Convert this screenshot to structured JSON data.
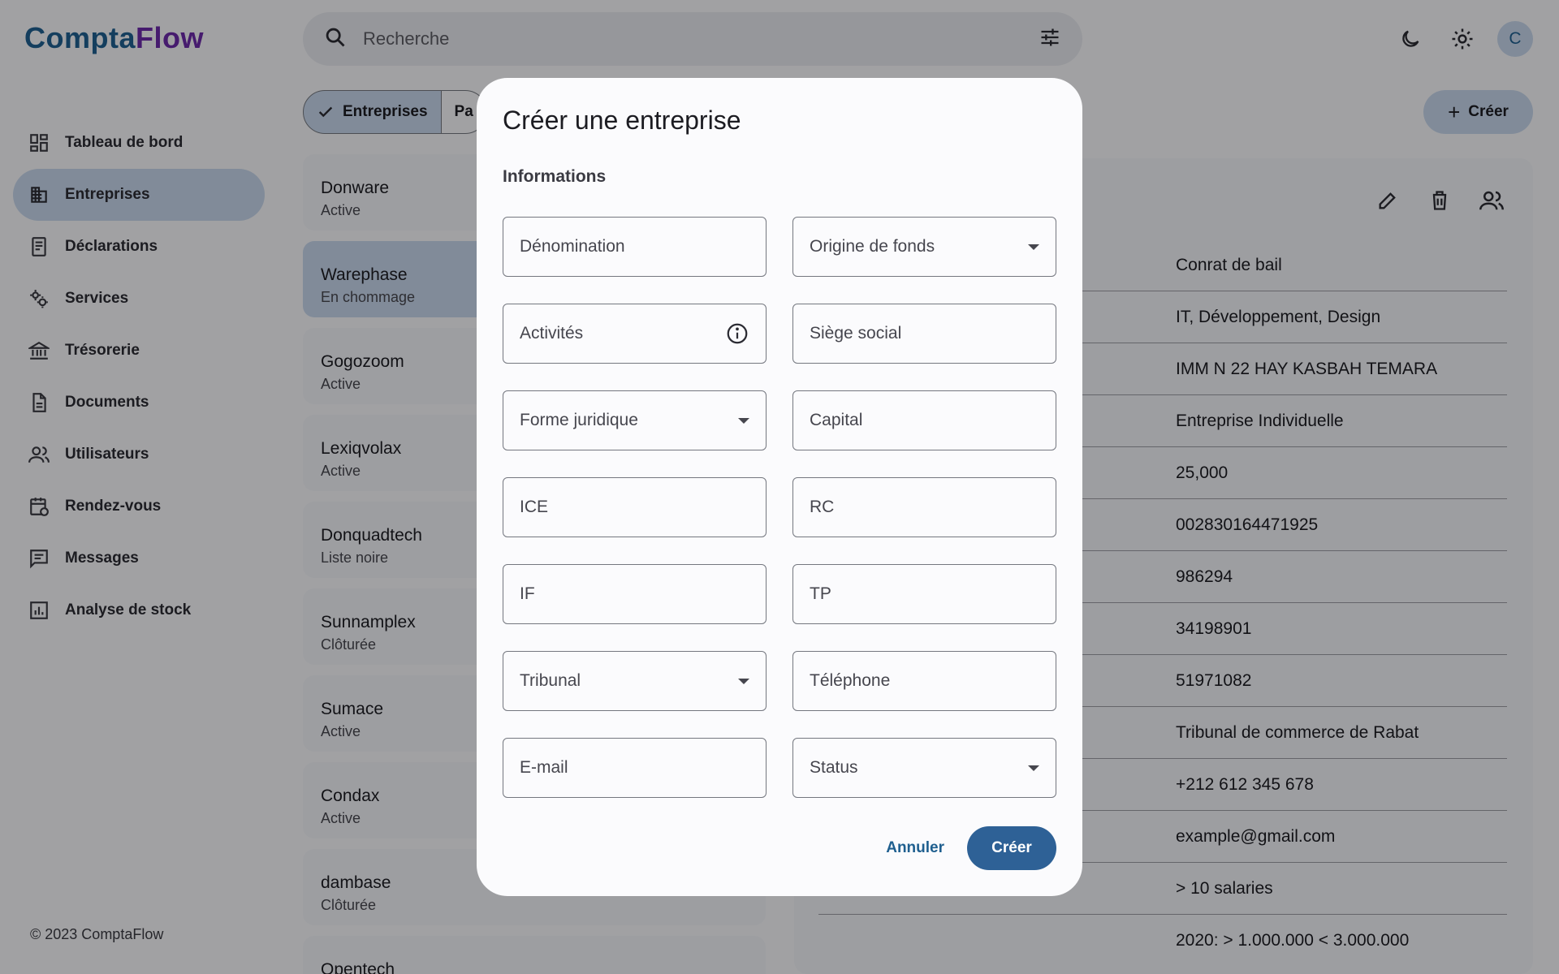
{
  "app": {
    "logo_part1": "Compta",
    "logo_part2": "Flow",
    "footer": "© 2023 ComptaFlow",
    "colors": {
      "primary": "#1f5f8f",
      "accent": "#6b2aa8",
      "selected": "#c4d4e8",
      "button": "#2e6196"
    }
  },
  "sidebar": {
    "items": [
      {
        "label": "Tableau de bord",
        "icon": "dashboard-icon"
      },
      {
        "label": "Entreprises",
        "icon": "building-icon"
      },
      {
        "label": "Déclarations",
        "icon": "document-list-icon"
      },
      {
        "label": "Services",
        "icon": "gears-icon"
      },
      {
        "label": "Trésorerie",
        "icon": "bank-icon"
      },
      {
        "label": "Documents",
        "icon": "file-icon"
      },
      {
        "label": "Utilisateurs",
        "icon": "users-icon"
      },
      {
        "label": "Rendez-vous",
        "icon": "calendar-icon"
      },
      {
        "label": "Messages",
        "icon": "message-icon"
      },
      {
        "label": "Analyse de stock",
        "icon": "chart-icon"
      }
    ]
  },
  "header": {
    "search_placeholder": "Recherche",
    "avatar_initial": "C"
  },
  "toolbar": {
    "chip_selected": "Entreprises",
    "chip_other": "Pa",
    "create_label": "Créer"
  },
  "companies": [
    {
      "name": "Donware",
      "status": "Active"
    },
    {
      "name": "Warephase",
      "status": "En chommage"
    },
    {
      "name": "Gogozoom",
      "status": "Active"
    },
    {
      "name": "Lexiqvolax",
      "status": "Active"
    },
    {
      "name": "Donquadtech",
      "status": "Liste noire"
    },
    {
      "name": "Sunnamplex",
      "status": "Clôturée"
    },
    {
      "name": "Sumace",
      "status": "Active"
    },
    {
      "name": "Condax",
      "status": "Active"
    },
    {
      "name": "dambase",
      "status": "Clôturée"
    },
    {
      "name": "Opentech",
      "status": ""
    }
  ],
  "detail": {
    "values": [
      "Conrat de bail",
      "IT, Développement, Design",
      "IMM N 22 HAY KASBAH TEMARA",
      "Entreprise Individuelle",
      "25,000",
      "002830164471925",
      "986294",
      "34198901",
      "51971082",
      "Tribunal de commerce de Rabat",
      "+212 612 345 678",
      "example@gmail.com",
      "> 10 salaries",
      "2020: > 1.000.000 < 3.000.000"
    ]
  },
  "dialog": {
    "title": "Créer une entreprise",
    "section": "Informations",
    "fields": {
      "denomination": "Dénomination",
      "origine": "Origine de fonds",
      "activites": "Activités",
      "siege": "Siège social",
      "forme": "Forme juridique",
      "capital": "Capital",
      "ice": "ICE",
      "rc": "RC",
      "if": "IF",
      "tp": "TP",
      "tribunal": "Tribunal",
      "telephone": "Téléphone",
      "email": "E-mail",
      "status": "Status"
    },
    "cancel": "Annuler",
    "submit": "Créer"
  }
}
